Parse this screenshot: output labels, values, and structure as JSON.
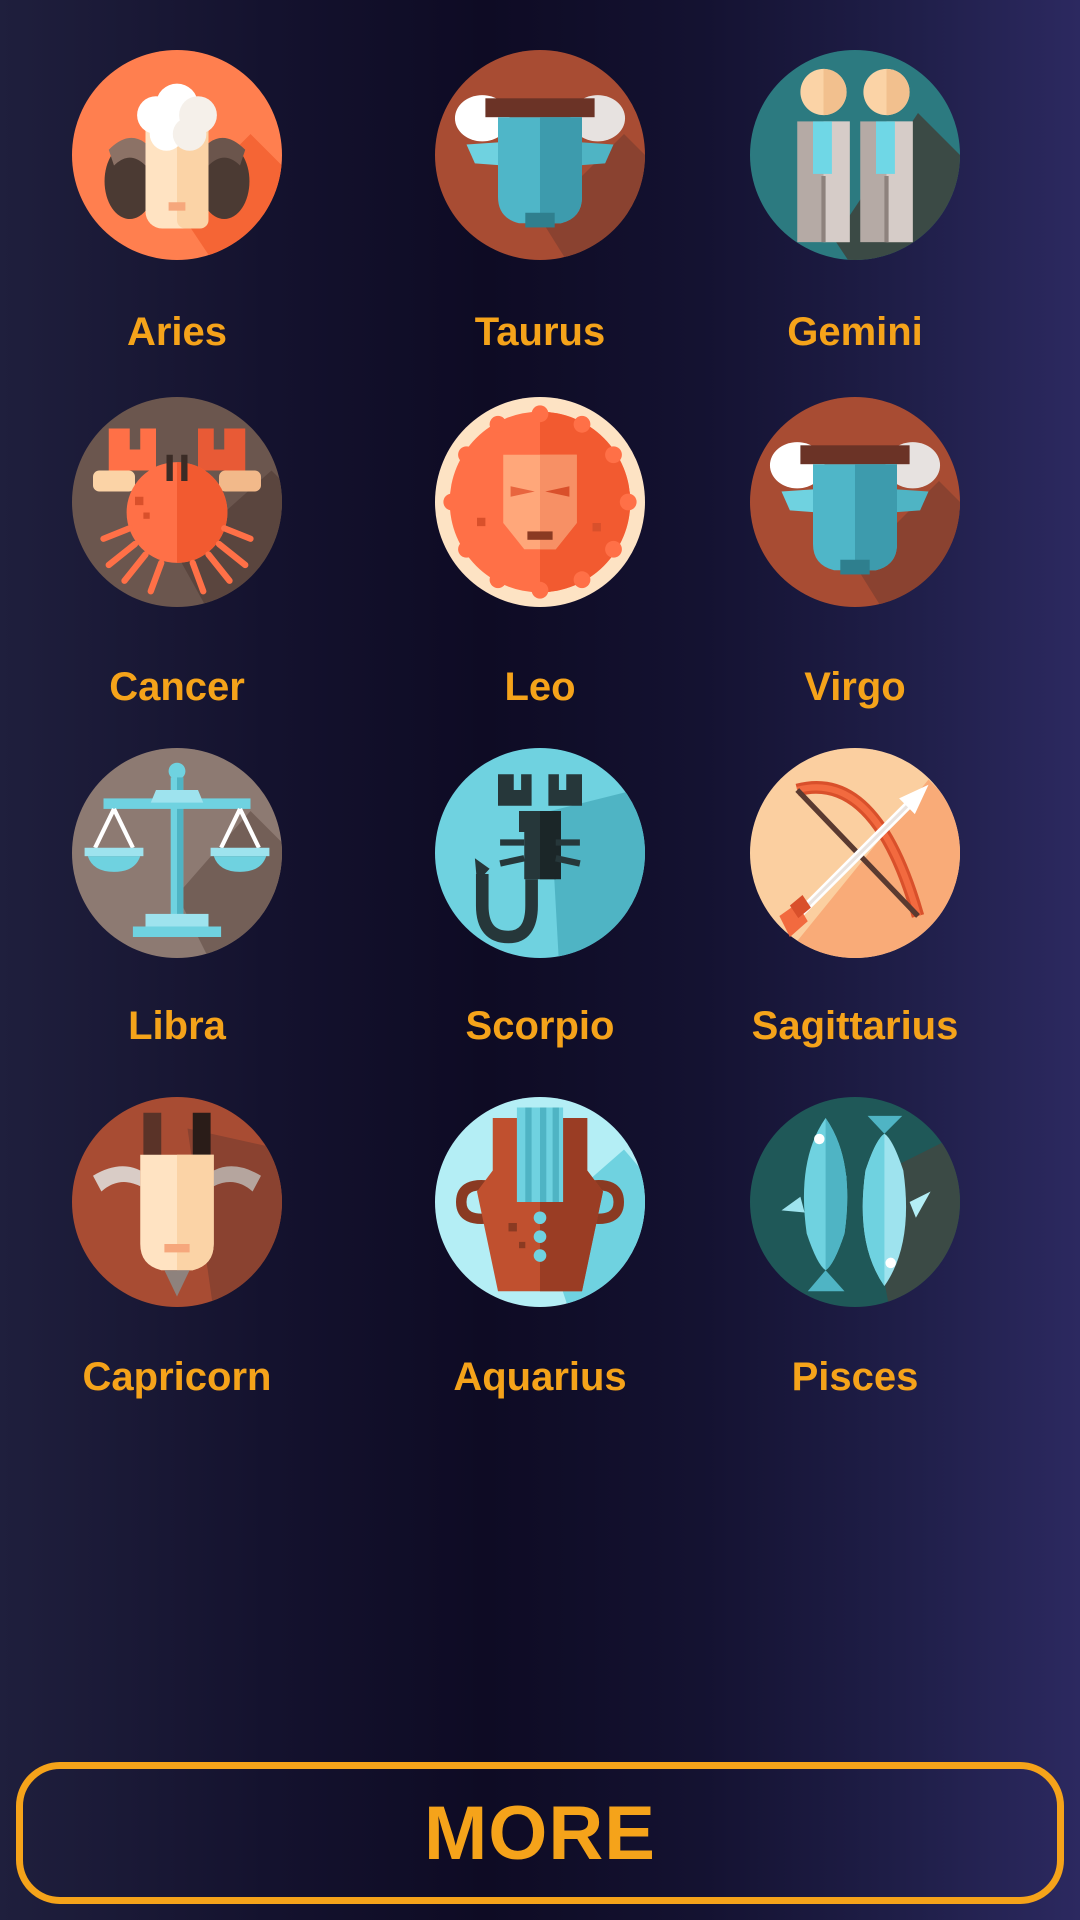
{
  "colors": {
    "accent": "#f5a31a",
    "background_dark": "#0e0b24",
    "background_light": "#2c2960"
  },
  "signs": [
    {
      "label": "Aries",
      "icon": "aries-ram-icon"
    },
    {
      "label": "Taurus",
      "icon": "taurus-bull-icon"
    },
    {
      "label": "Gemini",
      "icon": "gemini-twins-icon"
    },
    {
      "label": "Cancer",
      "icon": "cancer-crab-icon"
    },
    {
      "label": "Leo",
      "icon": "leo-lion-icon"
    },
    {
      "label": "Virgo",
      "icon": "virgo-bull-icon"
    },
    {
      "label": "Libra",
      "icon": "libra-scales-icon"
    },
    {
      "label": "Scorpio",
      "icon": "scorpio-scorpion-icon"
    },
    {
      "label": "Sagittarius",
      "icon": "sagittarius-bow-arrow-icon"
    },
    {
      "label": "Capricorn",
      "icon": "capricorn-goat-icon"
    },
    {
      "label": "Aquarius",
      "icon": "aquarius-vase-icon"
    },
    {
      "label": "Pisces",
      "icon": "pisces-fish-icon"
    }
  ],
  "more_button": {
    "label": "MORE"
  }
}
